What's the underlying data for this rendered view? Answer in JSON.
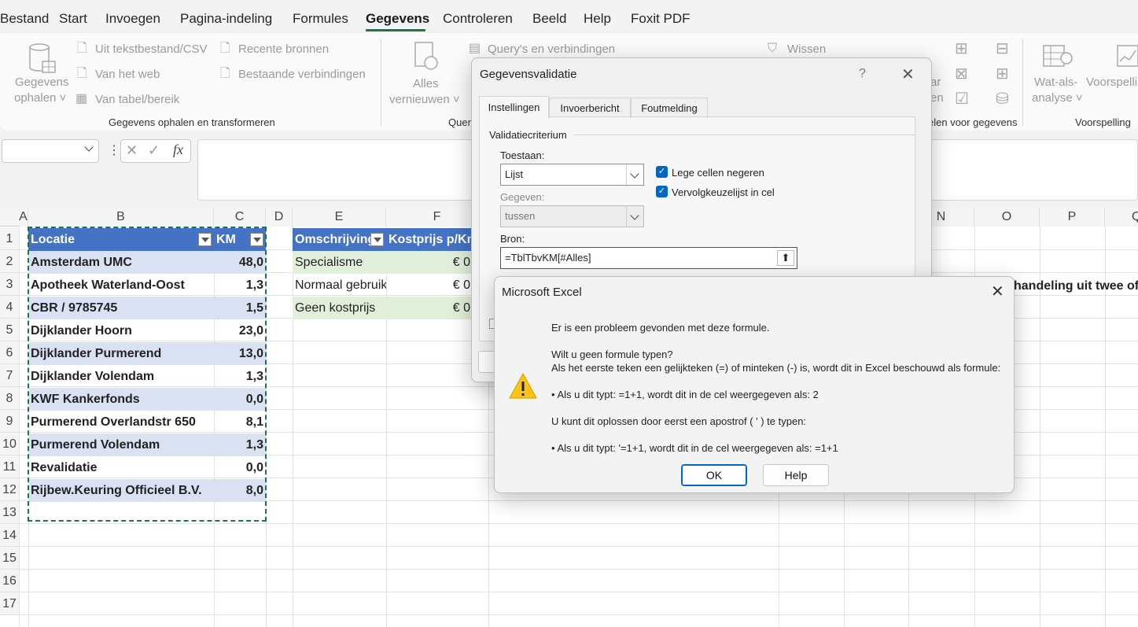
{
  "menu": {
    "items": [
      "Bestand",
      "Start",
      "Invoegen",
      "Pagina-indeling",
      "Formules",
      "Gegevens",
      "Controleren",
      "Beeld",
      "Help",
      "Foxit PDF"
    ],
    "active": "Gegevens"
  },
  "ribbon": {
    "get_data": {
      "label1": "Gegevens",
      "label2": "ophalen ˅"
    },
    "from_text": "Uit tekstbestand/CSV",
    "from_web": "Van het web",
    "from_table": "Van tabel/bereik",
    "recent": "Recente bronnen",
    "existing": "Bestaande verbindingen",
    "group1": "Gegevens ophalen en transformeren",
    "refresh1": "Alles",
    "refresh2": "vernieuwen ˅",
    "queries": "Query's en verbindingen",
    "group2": "Quer",
    "clear": "Wissen",
    "group3": "elen voor gegevens",
    "whatif1": "Wat-als-",
    "whatif2": "analyse ˅",
    "forecast1": "Voorspelling",
    "group4": "Voorspelling",
    "partial1": "ar",
    "partial2": "en"
  },
  "formula_bar": {
    "fx": "fx",
    "value": ""
  },
  "columns": [
    "A",
    "B",
    "C",
    "D",
    "E",
    "F",
    "N",
    "O",
    "P",
    "Q"
  ],
  "rows": [
    "1",
    "2",
    "3",
    "4",
    "5",
    "6",
    "7",
    "8",
    "9",
    "10",
    "11",
    "12",
    "13",
    "14",
    "15",
    "16",
    "17"
  ],
  "table1": {
    "headers": [
      "Locatie",
      "KM"
    ],
    "rows": [
      [
        "Amsterdam UMC",
        "48,0"
      ],
      [
        "Apotheek Waterland-Oost",
        "1,3"
      ],
      [
        "CBR / 9785745",
        "1,5"
      ],
      [
        "Dijklander Hoorn",
        "23,0"
      ],
      [
        "Dijklander Purmerend",
        "13,0"
      ],
      [
        "Dijklander Volendam",
        "1,3"
      ],
      [
        "KWF Kankerfonds",
        "0,0"
      ],
      [
        "Purmerend Overlandstr 650",
        "8,1"
      ],
      [
        "Purmerend Volendam",
        "1,3"
      ],
      [
        "Revalidatie",
        "0,0"
      ],
      [
        "Rijbew.Keuring Officieel B.V.",
        "8,0"
      ]
    ]
  },
  "table2": {
    "headers": [
      "Omschrijving",
      "Kostprijs p/Km"
    ],
    "rows": [
      [
        "Specialisme",
        "€ 0"
      ],
      [
        "Normaal gebruik",
        "€ 0"
      ],
      [
        "Geen kostprijs",
        "€ 0"
      ]
    ]
  },
  "side_text": "handeling uit twee of m",
  "validation_dialog": {
    "title": "Gegevensvalidatie",
    "help": "?",
    "tabs": [
      "Instellingen",
      "Invoerbericht",
      "Foutmelding"
    ],
    "section": "Validatiecriterium",
    "allow_label": "Toestaan:",
    "allow_value": "Lijst",
    "data_label": "Gegeven:",
    "data_value": "tussen",
    "source_label": "Bron:",
    "source_value": "=TblTbvKM[#Alles]",
    "ignore_blank": "Lege cellen negeren",
    "dropdown": "Vervolgkeuzelijst in cel"
  },
  "error_dialog": {
    "title": "Microsoft Excel",
    "line1": "Er is een probleem gevonden met deze formule.",
    "line2": "Wilt u geen formule typen?",
    "line3": "Als het eerste teken een gelijkteken (=) of minteken (-) is, wordt dit in Excel beschouwd als formule:",
    "line4": "• Als u dit typt:   =1+1, wordt dit in de cel weergegeven als:   2",
    "line5": "U kunt dit oplossen door eerst een apostrof ( ' ) te typen:",
    "line6": "• Als u dit typt:   '=1+1, wordt dit in de cel weergegeven als:   =1+1",
    "ok": "OK",
    "help": "Help"
  },
  "colors": {
    "accent": "#217346",
    "table_header": "#4472c4",
    "band": "#d9e1f2",
    "green_band": "#e2efda",
    "primary": "#0067c0"
  }
}
